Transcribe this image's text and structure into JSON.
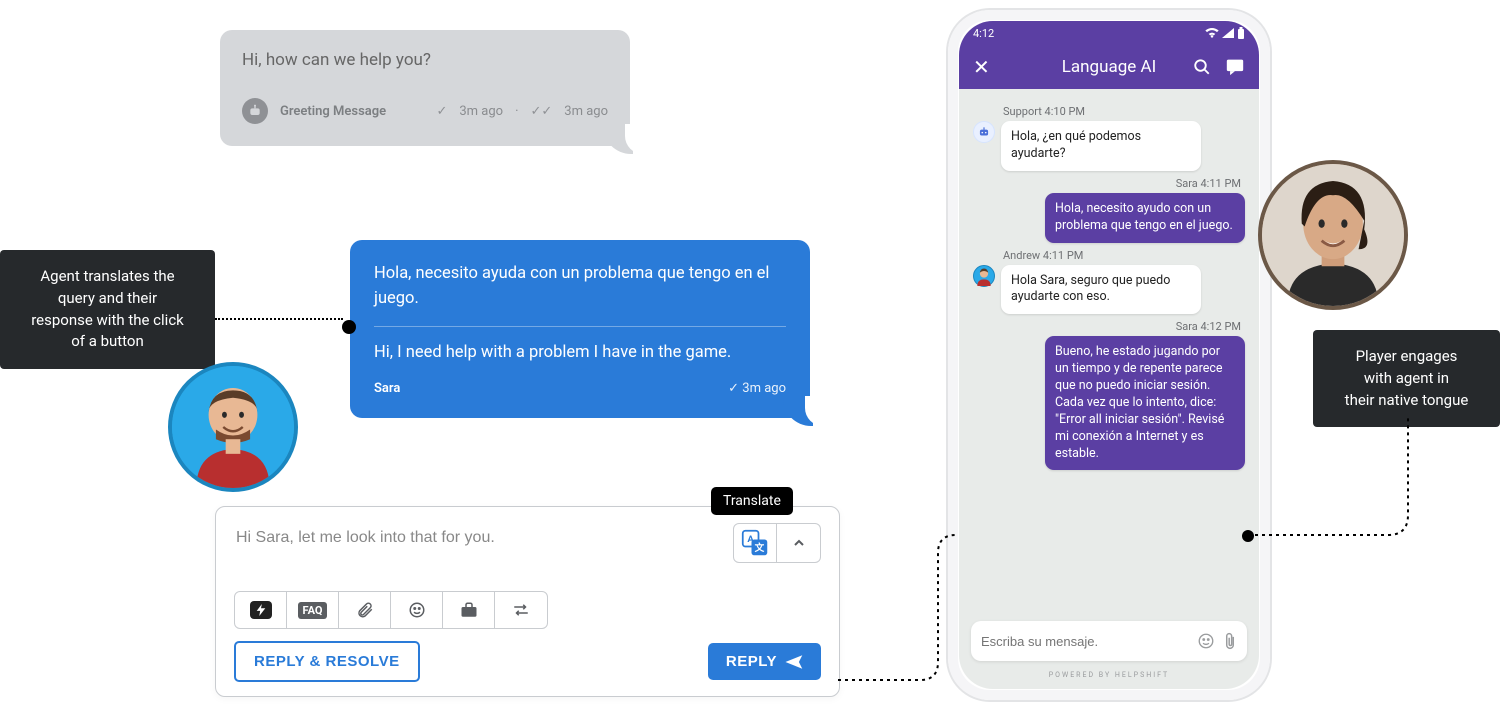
{
  "agent": {
    "greeting": {
      "text": "Hi, how can we help you?",
      "label": "Greeting Message",
      "time_a": "3m ago",
      "time_b": "3m ago"
    },
    "customer_msg": {
      "original": "Hola, necesito ayuda con un problema que tengo en el juego.",
      "translated": "Hi, I need help with a problem I have in the game.",
      "sender": "Sara",
      "time": "3m ago"
    },
    "compose": {
      "text": "Hi Sara, let me look into that for you.",
      "translate_tooltip": "Translate",
      "faq_label": "FAQ",
      "reply_resolve": "REPLY & RESOLVE",
      "reply": "REPLY"
    }
  },
  "annotation_left": {
    "l1": "Agent translates the",
    "l2": "query and their",
    "l3": "response with the click",
    "l4": "of a button"
  },
  "annotation_right": {
    "l1": "Player engages",
    "l2": "with agent in",
    "l3": "their native tongue"
  },
  "phone": {
    "clock": "4:12",
    "app_title": "Language AI",
    "messages": {
      "support_meta": "Support 4:10 PM",
      "support_text": "Hola, ¿en qué podemos ayudarte?",
      "sara1_meta": "Sara 4:11 PM",
      "sara1_text": "Hola, necesito ayudo con un problema que tengo en el juego.",
      "andrew_meta": "Andrew 4:11 PM",
      "andrew_text": "Hola Sara, seguro que puedo ayudarte con eso.",
      "sara2_meta": "Sara 4:12 PM",
      "sara2_text": "Bueno, he estado jugando por un tiempo y de repente parece que no puedo iniciar sesión. Cada vez que lo intento, dice: \"Error all iniciar sesión\". Revisé mi conexión a Internet y es estable."
    },
    "compose_placeholder": "Escriba su mensaje.",
    "powered": "POWERED BY HELPSHIFT"
  }
}
